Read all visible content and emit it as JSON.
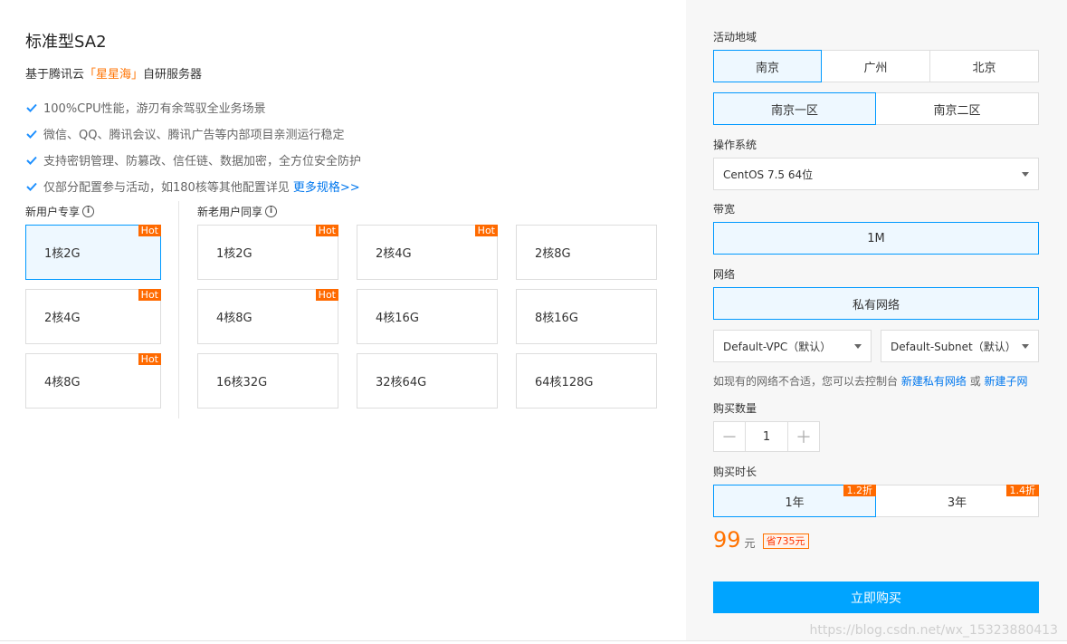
{
  "product": {
    "title": "标准型SA2",
    "subtitle_prefix": "基于腾讯云",
    "subtitle_highlight": "「星星海」",
    "subtitle_suffix": "自研服务器",
    "features": [
      "100%CPU性能，游刃有余驾驭全业务场景",
      "微信、QQ、腾讯会议、腾讯广告等内部项目亲测运行稳定",
      "支持密钥管理、防篡改、信任链、数据加密，全方位安全防护",
      "仅部分配置参与活动，如180核等其他配置详见"
    ],
    "more_link": "更多规格>>"
  },
  "new_user": {
    "label": "新用户专享",
    "specs": [
      {
        "label": "1核2G",
        "hot": "Hot"
      },
      {
        "label": "2核4G",
        "hot": "Hot"
      },
      {
        "label": "4核8G",
        "hot": "Hot"
      }
    ]
  },
  "all_user": {
    "label": "新老用户同享",
    "specs": [
      {
        "label": "1核2G",
        "hot": "Hot"
      },
      {
        "label": "2核4G",
        "hot": "Hot"
      },
      {
        "label": "2核8G"
      },
      {
        "label": "4核8G",
        "hot": "Hot"
      },
      {
        "label": "4核16G"
      },
      {
        "label": "8核16G"
      },
      {
        "label": "16核32G"
      },
      {
        "label": "32核64G"
      },
      {
        "label": "64核128G"
      }
    ]
  },
  "order": {
    "region_label": "活动地域",
    "regions": [
      "南京",
      "广州",
      "北京"
    ],
    "zones": [
      "南京一区",
      "南京二区"
    ],
    "os_label": "操作系统",
    "os_value": "CentOS 7.5 64位",
    "bandwidth_label": "带宽",
    "bandwidth_value": "1M",
    "network_label": "网络",
    "network_value": "私有网络",
    "vpc_value": "Default-VPC（默认）",
    "subnet_value": "Default-Subnet（默认）",
    "hint_prefix": "如现有的网络不合适，您可以去控制台",
    "hint_link1": "新建私有网络",
    "hint_or": "或",
    "hint_link2": "新建子网",
    "qty_label": "购买数量",
    "qty_minus": "－",
    "qty_value": "1",
    "qty_plus": "＋",
    "duration_label": "购买时长",
    "durations": [
      {
        "label": "1年",
        "discount": "1.2折"
      },
      {
        "label": "3年",
        "discount": "1.4折"
      }
    ],
    "price": "99",
    "price_unit": "元",
    "save_text": "省735元",
    "buy_label": "立即购买"
  },
  "watermark": "https://blog.csdn.net/wx_15323880413",
  "colors": {
    "accent": "#0099ff",
    "orange": "#ff6a00",
    "buy": "#00a4ff"
  }
}
